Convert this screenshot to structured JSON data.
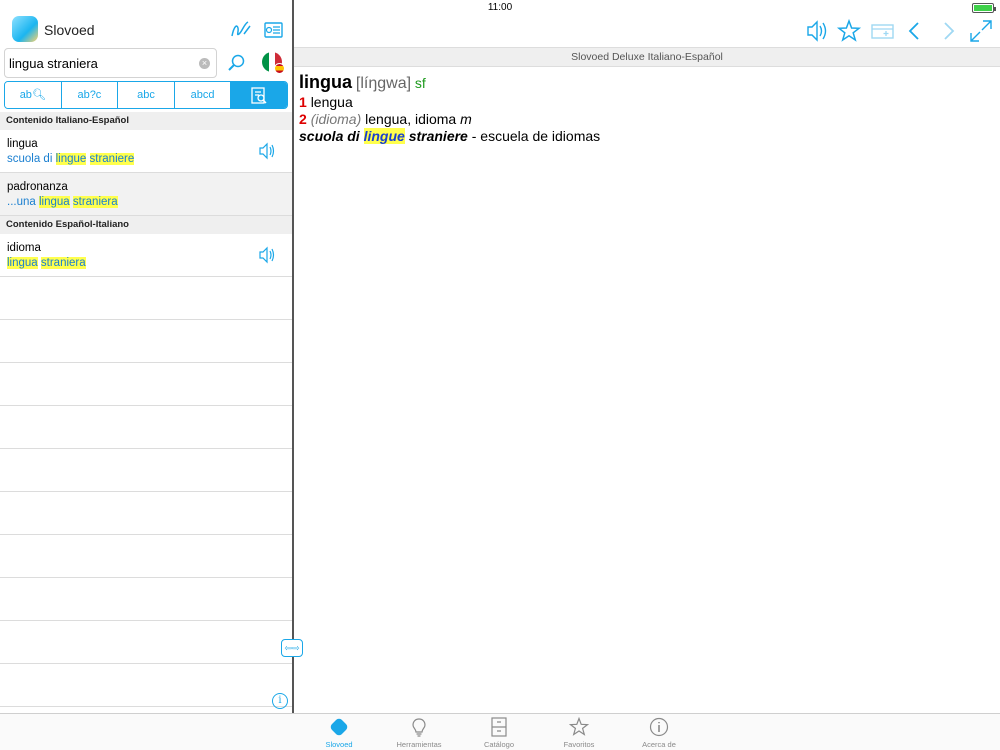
{
  "status": {
    "time": "11:00"
  },
  "app": {
    "name": "Slovoed"
  },
  "search": {
    "value": "lingua straniera",
    "placeholder": ""
  },
  "modes": [
    {
      "label": "ab"
    },
    {
      "label": "ab?c"
    },
    {
      "label": "abc"
    },
    {
      "label": "abcd"
    },
    {
      "label": ""
    }
  ],
  "list": {
    "section1": "Contenido Italiano-Español",
    "section2": "Contenido Español-Italiano",
    "rows": [
      {
        "headword": "lingua",
        "pre": "scuola di ",
        "hl1": "lingue",
        "mid": " ",
        "hl2": "straniere"
      },
      {
        "headword": "padronanza",
        "pre": "...una ",
        "hl1": "lingua",
        "mid": " ",
        "hl2": "straniera"
      },
      {
        "headword": "idioma",
        "pre": "",
        "hl1": "lingua",
        "mid": " ",
        "hl2": "straniera"
      }
    ]
  },
  "dictionary": {
    "title": "Slovoed Deluxe Italiano-Español"
  },
  "article": {
    "headword": "lingua",
    "transcription": "[líŋgwa]",
    "pos": "sf",
    "sense1": {
      "num": "1",
      "text": "lengua"
    },
    "sense2": {
      "num": "2",
      "label": "(idioma)",
      "text": "lengua, idioma",
      "gender": "m"
    },
    "example": {
      "pre": "scuola di ",
      "hl": "lingue",
      "post": " straniere",
      "translation": " - escuela de idiomas"
    }
  },
  "tabs": [
    {
      "label": "Slovoed",
      "icon": "slovoed-icon"
    },
    {
      "label": "Herramientas",
      "icon": "lightbulb-icon"
    },
    {
      "label": "Catálogo",
      "icon": "cabinet-icon"
    },
    {
      "label": "Favoritos",
      "icon": "star-icon"
    },
    {
      "label": "Acerca de",
      "icon": "info-icon"
    }
  ],
  "colors": {
    "accent": "#1aa7e8",
    "highlight": "#ffff4d",
    "sense_number": "#dd0000",
    "pos": "#1e9a1e"
  }
}
